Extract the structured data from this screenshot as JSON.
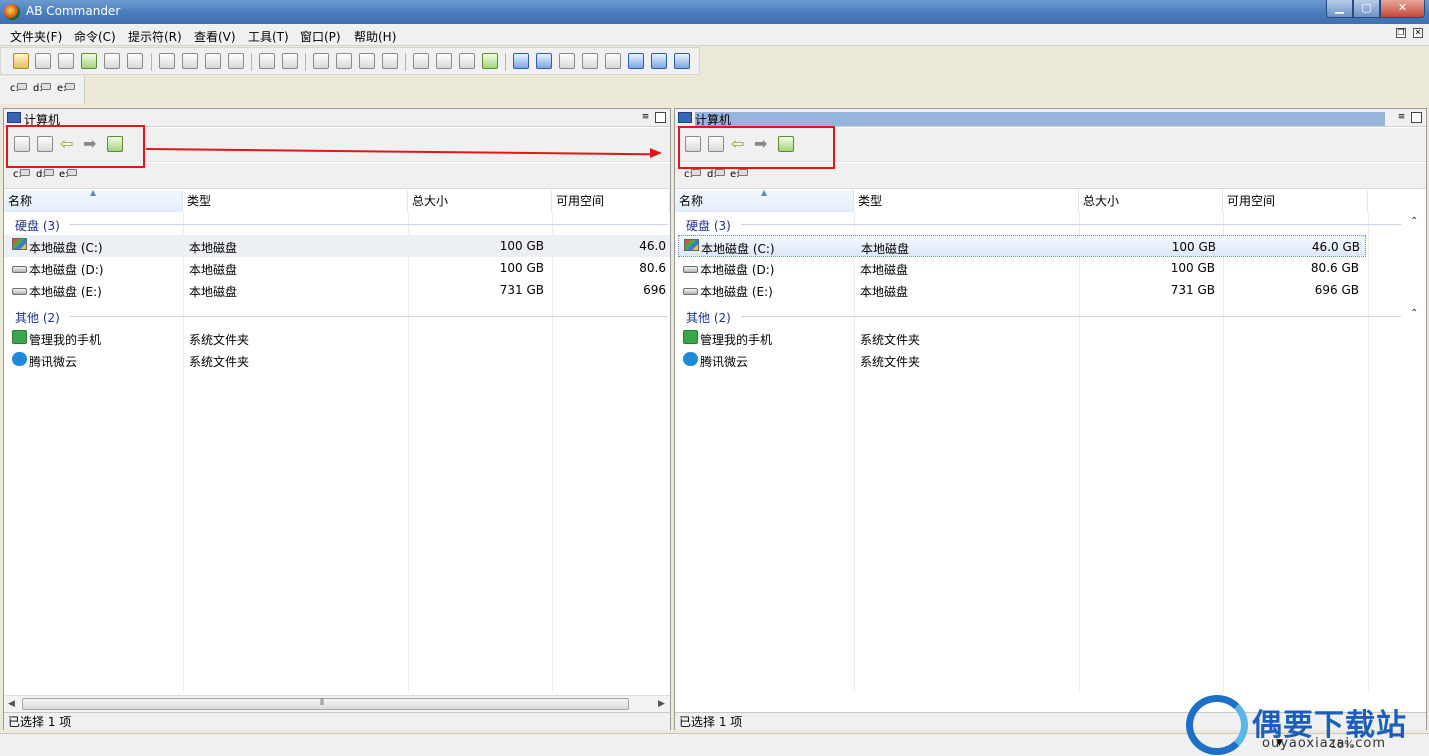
{
  "window": {
    "title": "AB Commander"
  },
  "menu": [
    "文件夹(F)",
    "命令(C)",
    "提示符(R)",
    "查看(V)",
    "工具(T)",
    "窗口(P)",
    "帮助(H)"
  ],
  "drives": [
    "c:",
    "d:",
    "e:"
  ],
  "columns": [
    "名称",
    "类型",
    "总大小",
    "可用空间"
  ],
  "left_panel": {
    "title": "计算机",
    "groups": [
      {
        "label": "硬盘 (3)",
        "rows": [
          {
            "name": "本地磁盘 (C:)",
            "type": "本地磁盘",
            "size": "100 GB",
            "free": "46.0",
            "icon": "system-disk-icon"
          },
          {
            "name": "本地磁盘 (D:)",
            "type": "本地磁盘",
            "size": "100 GB",
            "free": "80.6",
            "icon": "disk-icon"
          },
          {
            "name": "本地磁盘 (E:)",
            "type": "本地磁盘",
            "size": "731 GB",
            "free": "696",
            "icon": "disk-icon"
          }
        ]
      },
      {
        "label": "其他 (2)",
        "rows": [
          {
            "name": "管理我的手机",
            "type": "系统文件夹",
            "size": "",
            "free": "",
            "icon": "phone-icon"
          },
          {
            "name": "腾讯微云",
            "type": "系统文件夹",
            "size": "",
            "free": "",
            "icon": "cloud-icon"
          }
        ]
      }
    ],
    "status": "已选择 1 项"
  },
  "right_panel": {
    "title": "计算机",
    "groups": [
      {
        "label": "硬盘 (3)",
        "rows": [
          {
            "name": "本地磁盘 (C:)",
            "type": "本地磁盘",
            "size": "100 GB",
            "free": "46.0 GB",
            "icon": "system-disk-icon"
          },
          {
            "name": "本地磁盘 (D:)",
            "type": "本地磁盘",
            "size": "100 GB",
            "free": "80.6 GB",
            "icon": "disk-icon"
          },
          {
            "name": "本地磁盘 (E:)",
            "type": "本地磁盘",
            "size": "731 GB",
            "free": "696 GB",
            "icon": "disk-icon"
          }
        ]
      },
      {
        "label": "其他 (2)",
        "rows": [
          {
            "name": "管理我的手机",
            "type": "系统文件夹",
            "size": "",
            "free": "",
            "icon": "phone-icon"
          },
          {
            "name": "腾讯微云",
            "type": "系统文件夹",
            "size": "",
            "free": "",
            "icon": "cloud-icon"
          }
        ]
      }
    ],
    "status": "已选择 1 项"
  },
  "statusbar": {
    "zoom": "18%"
  },
  "watermark": {
    "name": "偶要下载站",
    "url": "ouyaoxiazai.com"
  },
  "colors": {
    "annotation": "#e01818",
    "group_text": "#1e3287",
    "title_bar": "#4a7dbd"
  }
}
